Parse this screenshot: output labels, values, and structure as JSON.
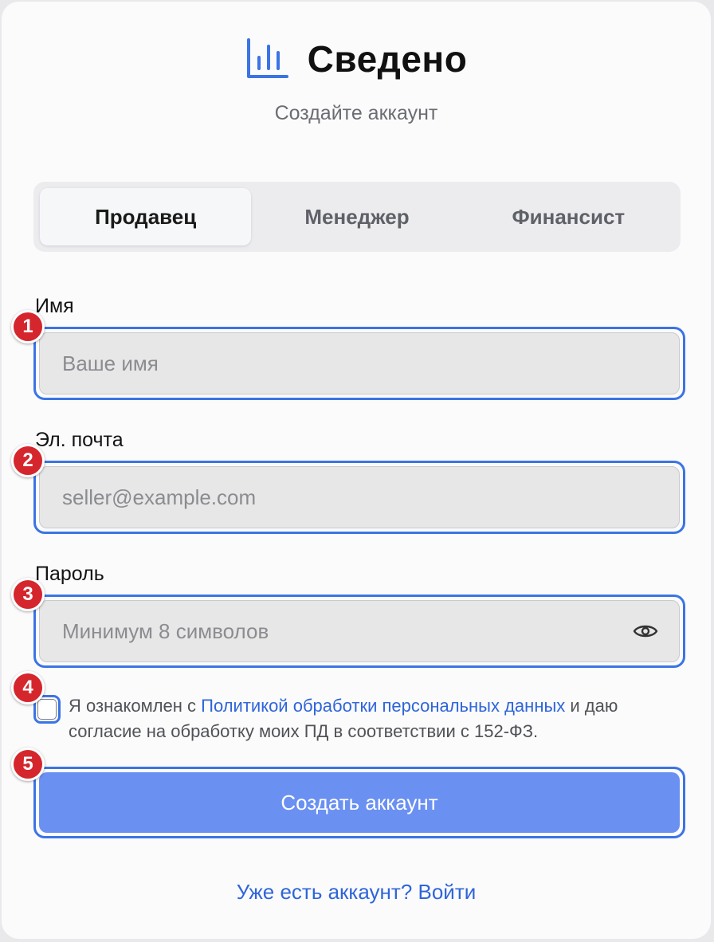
{
  "brand": {
    "name": "Сведено",
    "icon": "bar-chart-icon"
  },
  "subtitle": "Создайте аккаунт",
  "tabs": [
    {
      "label": "Продавец",
      "active": true
    },
    {
      "label": "Менеджер",
      "active": false
    },
    {
      "label": "Финансист",
      "active": false
    }
  ],
  "form": {
    "name": {
      "label": "Имя",
      "placeholder": "Ваше имя",
      "value": ""
    },
    "email": {
      "label": "Эл. почта",
      "placeholder": "seller@example.com",
      "value": ""
    },
    "password": {
      "label": "Пароль",
      "placeholder": "Минимум 8 символов",
      "value": "",
      "toggle_icon": "eye-icon"
    }
  },
  "consent": {
    "checked": false,
    "text_before": "Я ознакомлен с ",
    "link_text": "Политикой обработки персональных данных",
    "text_after": " и даю согласие на обработку моих ПД в соответствии с 152-ФЗ."
  },
  "submit_label": "Создать аккаунт",
  "login_link": "Уже есть аккаунт? Войти",
  "badges": [
    "1",
    "2",
    "3",
    "4",
    "5"
  ],
  "colors": {
    "accent": "#3b74e4",
    "button": "#6a90f2",
    "badge": "#d4262c",
    "link": "#2f65d9"
  }
}
